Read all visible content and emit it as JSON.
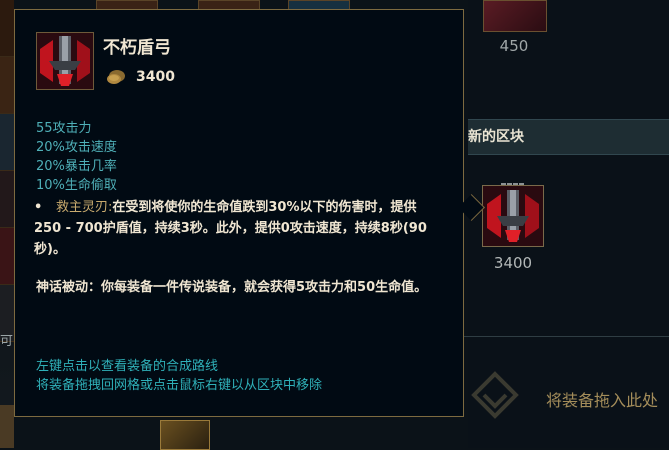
{
  "item": {
    "name": "不朽盾弓",
    "cost": "3400",
    "stats": [
      "55攻击力",
      "20%攻击速度",
      "20%暴击几率",
      "10%生命偷取"
    ],
    "passive_bullet": "•",
    "passive_name": "救主灵刃:",
    "passive_text": "在受到将使你的生命值跌到30%以下的伤害时，提供250 - 700护盾值，持续3秒。此外，提供0攻击速度，持续8秒(90秒)。",
    "mythic_text": "神话被动：你每装备一件传说装备，就会获得5攻击力和50生命值。",
    "hints": [
      "左键点击以查看装备的合成路线",
      "将装备拖拽回网格或点击鼠标右键以从区块中移除"
    ],
    "gold_icon": "gold-coin-icon",
    "icon": "immortal-shieldbow-icon"
  },
  "right_panel": {
    "top_price": "450",
    "header": "新的区块",
    "item_price": "3400",
    "drop_text": "将装备拖入此处"
  },
  "left_panel": {
    "partial_text": "可"
  },
  "colors": {
    "tooltip_bg": "#010a13",
    "tooltip_border": "#7d6a40",
    "stat_color": "#4fb0b8",
    "gold_text": "#c8aa6e",
    "body_text": "#f0e6d2"
  }
}
